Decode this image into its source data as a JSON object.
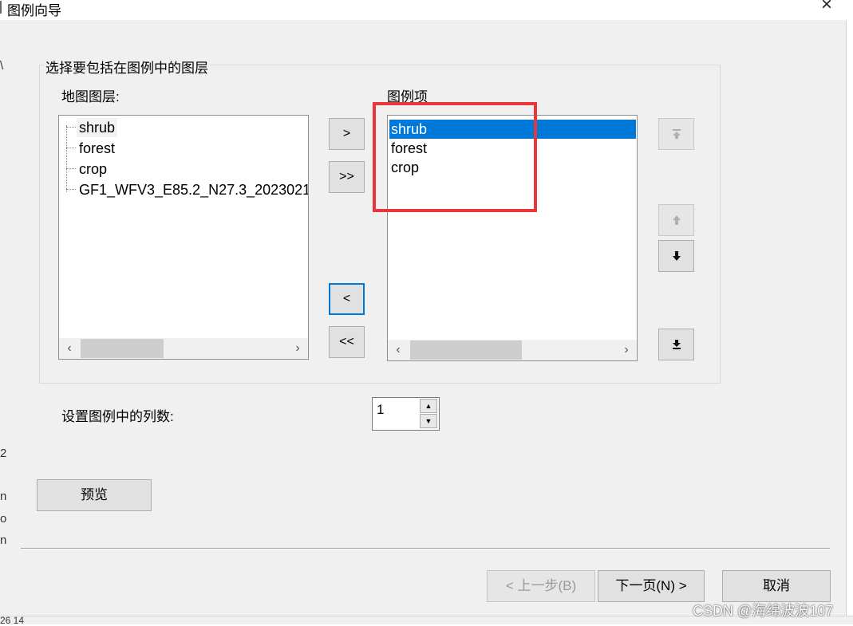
{
  "window": {
    "title": "图例向导"
  },
  "layer_group": {
    "label": "选择要包括在图例中的图层"
  },
  "map_layers": {
    "label": "地图图层:",
    "items": [
      "shrub",
      "forest",
      "crop",
      "GF1_WFV3_E85.2_N27.3_2023021"
    ]
  },
  "legend_items": {
    "label": "图例项",
    "items": [
      "shrub",
      "forest",
      "crop"
    ],
    "selected_index": 0
  },
  "transfer_buttons": {
    "add_one": ">",
    "add_all": ">>",
    "remove_one": "<",
    "remove_all": "<<"
  },
  "order_buttons": {
    "move_top_icon": "move-to-top-icon",
    "move_up_icon": "move-up-icon",
    "move_down_icon": "move-down-icon",
    "move_bottom_icon": "move-to-bottom-icon"
  },
  "columns": {
    "label": "设置图例中的列数:",
    "value": "1"
  },
  "preview_button": "预览",
  "footer": {
    "back_label": "< 上一步(B)",
    "next_label": "下一页(N) >",
    "cancel_label": "取消"
  },
  "watermark": "CSDN @海绵波波107",
  "background_fragments": {
    "left_glyphs": [
      "\\",
      "2",
      "n",
      "o",
      "n"
    ],
    "bottom_text": "26  14"
  },
  "colors": {
    "selection": "#0078d7",
    "highlight_box": "#e8363b",
    "dialog_bg": "#f0f0f0"
  }
}
